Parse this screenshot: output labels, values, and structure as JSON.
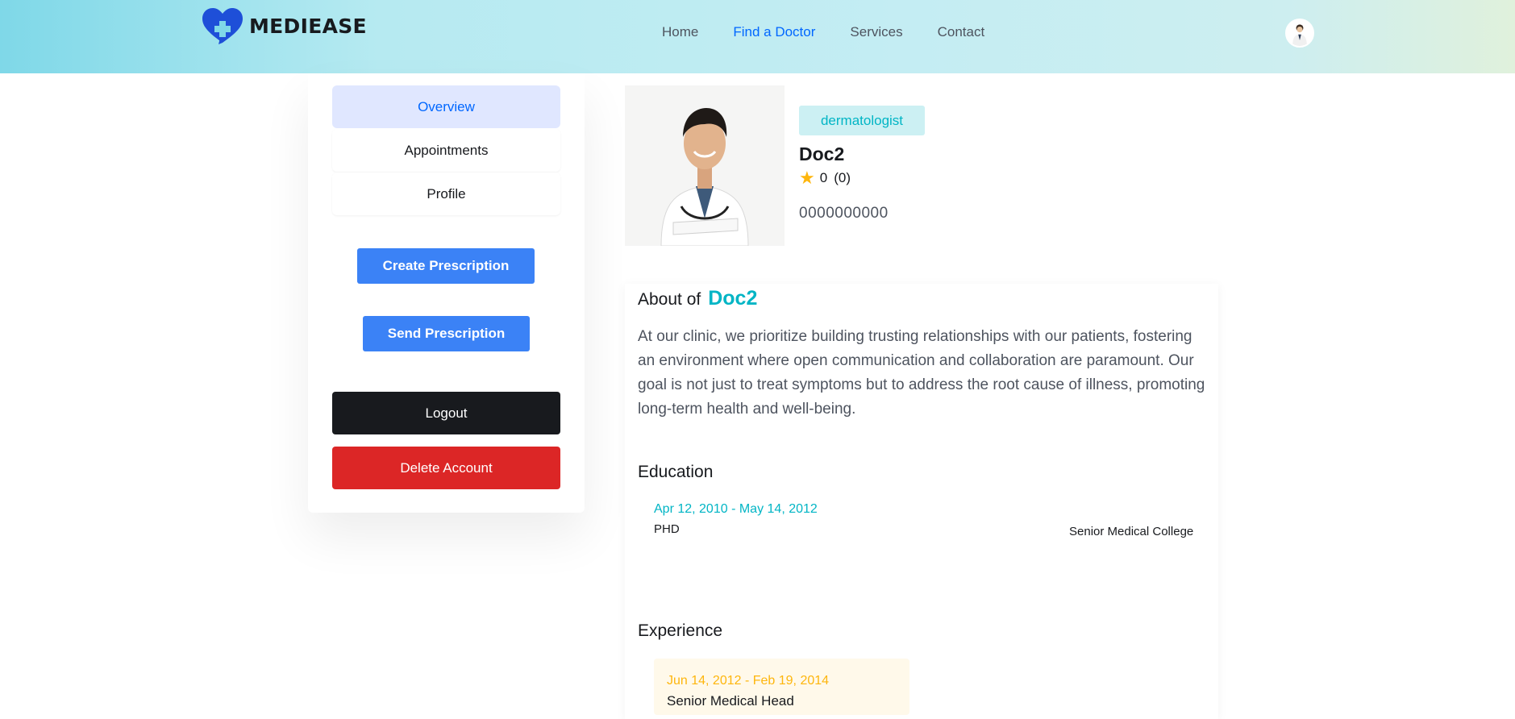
{
  "brand": {
    "name": "MEDIEASE",
    "colors": {
      "primary": "#0067ff",
      "teal": "#01b5c5",
      "yellow": "#feb60d",
      "danger": "#dc2626"
    }
  },
  "nav": {
    "items": [
      "Home",
      "Find a Doctor",
      "Services",
      "Contact"
    ],
    "active": "Find a Doctor"
  },
  "user": {
    "avatar_icon": "user-avatar"
  },
  "sidebar": {
    "tabs": [
      {
        "label": "Overview",
        "active": true
      },
      {
        "label": "Appointments",
        "active": false
      },
      {
        "label": "Profile",
        "active": false
      }
    ],
    "create_prescription_label": "Create Prescription",
    "send_prescription_label": "Send Prescription",
    "logout_label": "Logout",
    "delete_account_label": "Delete Account"
  },
  "doctor": {
    "specialization": "dermatologist",
    "name": "Doc2",
    "rating": "0",
    "reviews": "(0)",
    "phone": "0000000000"
  },
  "about": {
    "title": "About of",
    "name": "Doc2",
    "text": "At our clinic, we prioritize building trusting relationships with our patients, fostering an environment where open communication and collaboration are paramount. Our goal is not just to treat symptoms but to address the root cause of illness, promoting long-term health and well-being."
  },
  "education": {
    "title": "Education",
    "items": [
      {
        "dates": "Apr 12, 2010 - May 14, 2012",
        "degree": "PHD",
        "school": "Senior Medical College"
      }
    ]
  },
  "experience": {
    "title": "Experience",
    "items": [
      {
        "dates": "Jun 14, 2012 - Feb 19, 2014",
        "role": "Senior Medical Head"
      }
    ]
  }
}
